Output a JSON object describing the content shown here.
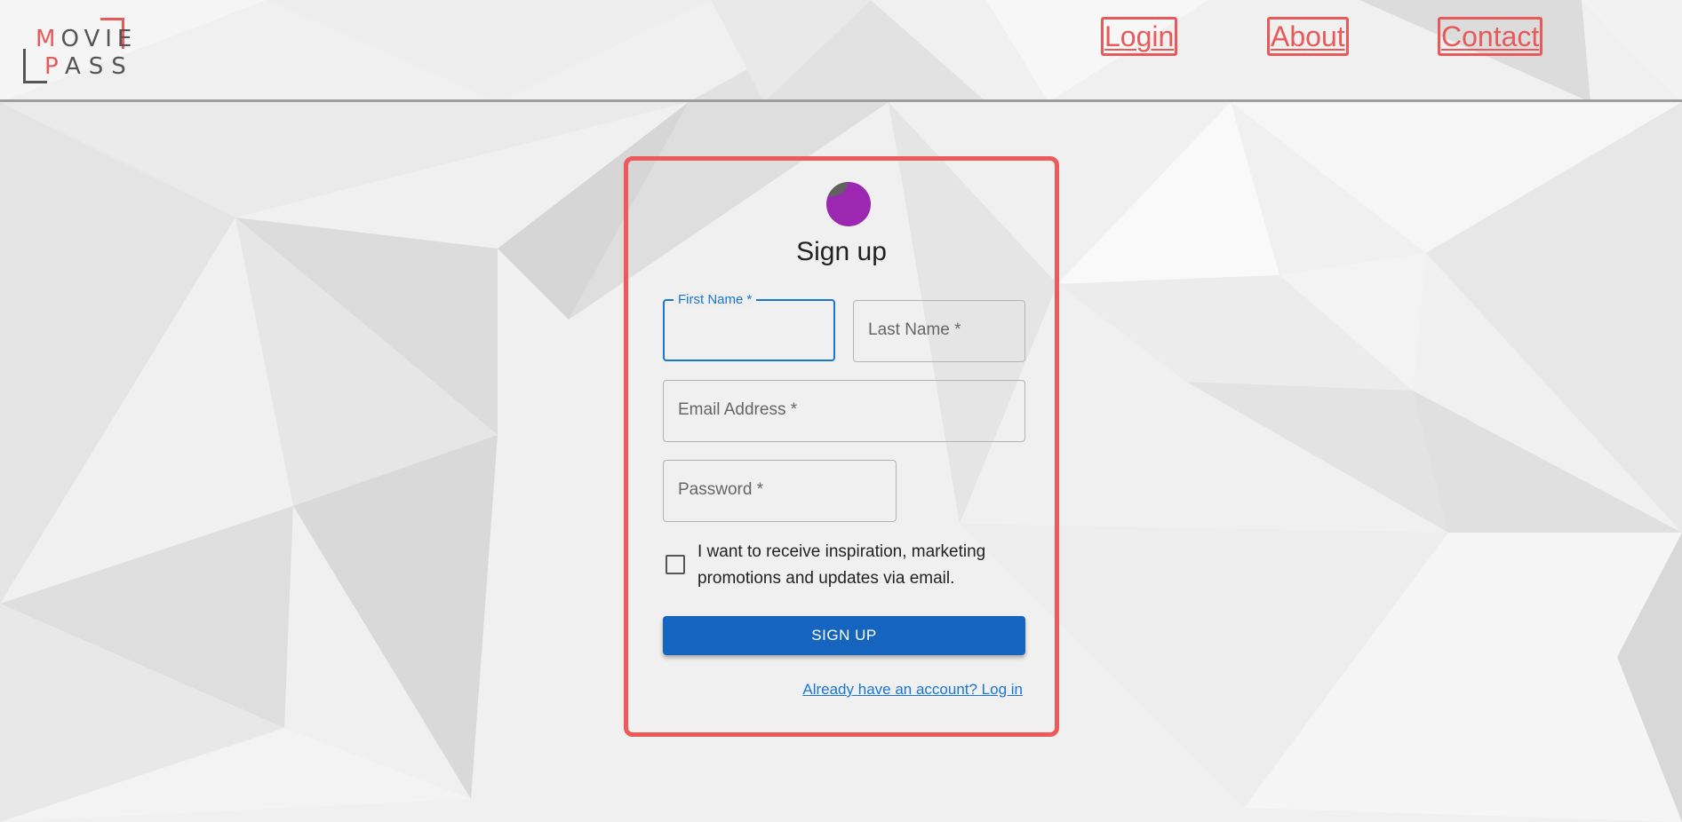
{
  "header": {
    "logo_line1_first": "M",
    "logo_line1_rest": "OVIE",
    "logo_line2_first": "P",
    "logo_line2_rest": "ASS",
    "nav": {
      "login": "Login",
      "about": "About",
      "contact": "Contact"
    }
  },
  "form": {
    "title": "Sign up",
    "first_name_label": "First Name *",
    "first_name_value": "",
    "last_name_placeholder": "Last Name *",
    "email_placeholder": "Email Address *",
    "password_placeholder": "Password *",
    "checkbox_text": "I want to receive inspiration, marketing promotions and updates via email.",
    "checkbox_checked": false,
    "submit_label": "SIGN UP",
    "login_link": "Already have an account? Log in"
  },
  "colors": {
    "accent_red": "#e85a5a",
    "primary_blue": "#1565c0",
    "avatar_purple": "#9c27b0"
  },
  "icons": {
    "avatar": "lock-icon"
  }
}
